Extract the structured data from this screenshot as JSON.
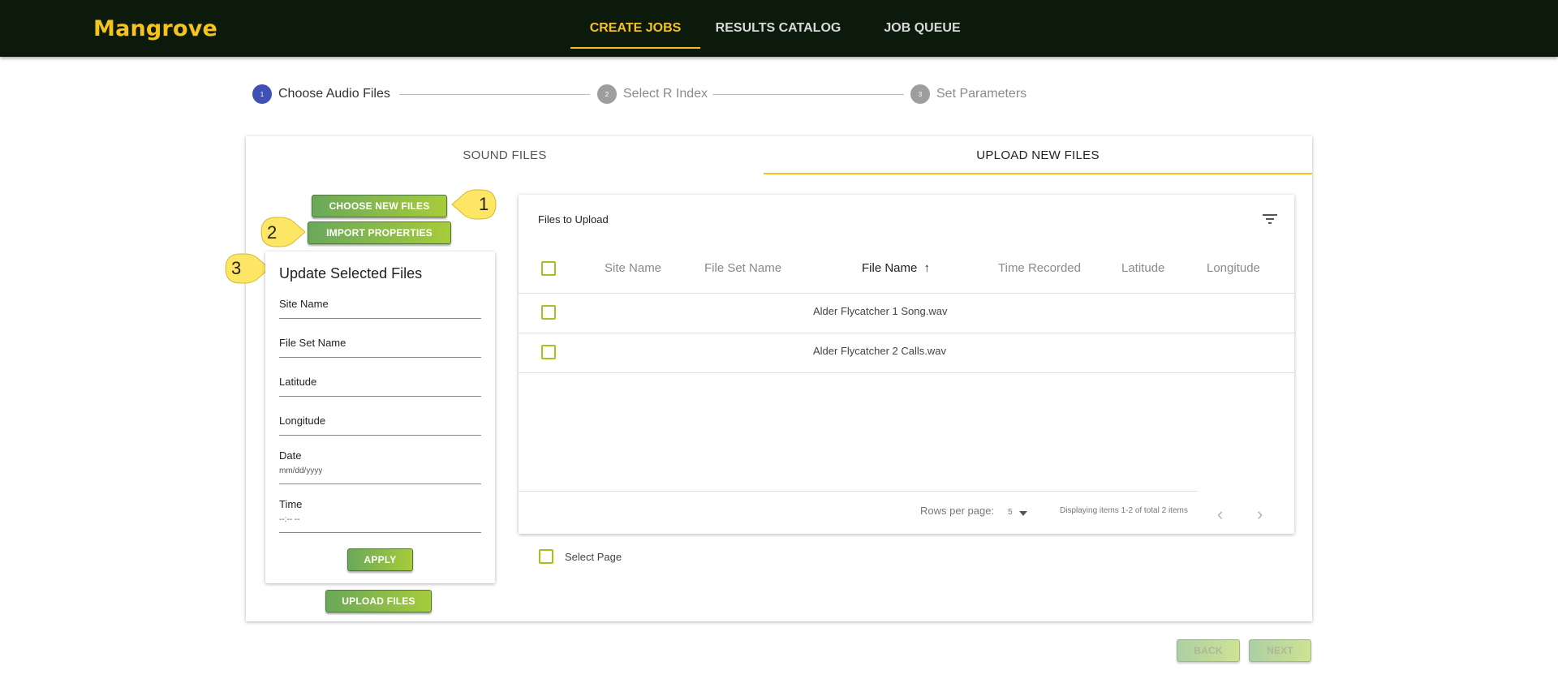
{
  "header": {
    "brand": "Mangrove",
    "tabs": [
      {
        "label": "CREATE JOBS",
        "active": true
      },
      {
        "label": "RESULTS CATALOG",
        "active": false
      },
      {
        "label": "JOB QUEUE",
        "active": false
      }
    ]
  },
  "stepper": {
    "steps": [
      {
        "number": "1",
        "label": "Choose Audio Files",
        "active": true
      },
      {
        "number": "2",
        "label": "Select R Index",
        "active": false
      },
      {
        "number": "3",
        "label": "Set Parameters",
        "active": false
      }
    ]
  },
  "tabs": {
    "sound_files": "SOUND FILES",
    "upload_new_files": "UPLOAD NEW FILES"
  },
  "actions": {
    "choose_new_files": "CHOOSE NEW FILES",
    "import_properties": "IMPORT PROPERTIES",
    "apply": "APPLY",
    "upload_files": "UPLOAD FILES",
    "back": "BACK",
    "next": "NEXT"
  },
  "callouts": [
    "1",
    "2",
    "3"
  ],
  "update_panel": {
    "title": "Update Selected Files",
    "fields": {
      "site_name": "Site Name",
      "file_set_name": "File Set Name",
      "latitude": "Latitude",
      "longitude": "Longitude",
      "date": "Date",
      "date_placeholder": "mm/dd/yyyy",
      "time": "Time",
      "time_placeholder": "--:-- --"
    }
  },
  "files_table": {
    "title": "Files to Upload",
    "columns": [
      "Site Name",
      "File Set Name",
      "File Name",
      "Time Recorded",
      "Latitude",
      "Longitude"
    ],
    "sorted_column": "File Name",
    "sort_arrow": "↑",
    "rows": [
      {
        "site_name": "",
        "file_set_name": "",
        "file_name": "Alder Flycatcher 1 Song.wav",
        "time_recorded": "",
        "latitude": "",
        "longitude": ""
      },
      {
        "site_name": "",
        "file_set_name": "",
        "file_name": "Alder Flycatcher 2 Calls.wav",
        "time_recorded": "",
        "latitude": "",
        "longitude": ""
      }
    ],
    "pagination": {
      "rows_per_page_label": "Rows per page:",
      "rows_per_page_value": "5",
      "display_text": "Displaying items 1-2 of total 2 items"
    },
    "select_page_label": "Select Page"
  },
  "colors": {
    "header_bg": "#0b1a0b",
    "brand": "#f6c31b",
    "step_active": "#3f51b5",
    "checkbox": "#a4c31f",
    "callout": "#fde664"
  }
}
